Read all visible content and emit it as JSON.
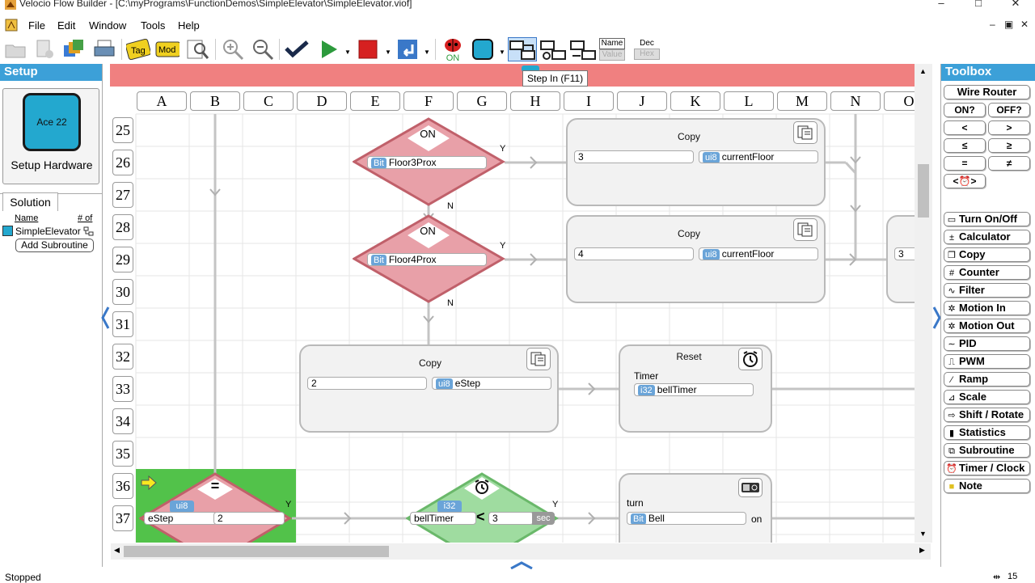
{
  "window": {
    "title": "Velocio Flow Builder - [C:\\myPrograms\\FunctionDemos\\SimpleElevator\\SimpleElevator.viof]",
    "controls": [
      "–",
      "□",
      "✕"
    ]
  },
  "menu": {
    "items": [
      "File",
      "Edit",
      "Window",
      "Tools",
      "Help"
    ],
    "mdi_controls": [
      "–",
      "▣",
      "✕"
    ]
  },
  "toolbar": {
    "tag_label": "Tag",
    "mod_label": "Mod",
    "on_label": "ON",
    "name_label": "Name",
    "value_label": "Value",
    "dec_label": "Dec",
    "hex_label": "Hex",
    "tooltip": "Step In (F11)"
  },
  "setup": {
    "header": "Setup",
    "device": "Ace 22",
    "button": "Setup Hardware"
  },
  "solution": {
    "tab": "Solution",
    "col_name": "Name",
    "col_count": "# of",
    "item": "SimpleElevator",
    "add_button": "Add Subroutine"
  },
  "grid": {
    "columns": [
      "A",
      "B",
      "C",
      "D",
      "E",
      "F",
      "G",
      "H",
      "I",
      "J",
      "K",
      "L",
      "M",
      "N",
      "O"
    ],
    "rows": [
      "25",
      "26",
      "27",
      "28",
      "29",
      "30",
      "31",
      "32",
      "33",
      "34",
      "35",
      "36",
      "37"
    ]
  },
  "flow": {
    "dec1": {
      "op": "ON",
      "tag": "Bit",
      "var": "Floor3Prox",
      "yes": "Y",
      "no": "N"
    },
    "dec2": {
      "op": "ON",
      "tag": "Bit",
      "var": "Floor4Prox",
      "yes": "Y",
      "no": "N"
    },
    "copy1": {
      "title": "Copy",
      "value": "3",
      "tag": "ui8",
      "var": "currentFloor"
    },
    "copy2": {
      "title": "Copy",
      "value": "4",
      "tag": "ui8",
      "var": "currentFloor"
    },
    "copy3": {
      "title": "Copy",
      "value": "2",
      "tag": "ui8",
      "var": "eStep"
    },
    "copy4_value": "3",
    "reset": {
      "title": "Reset",
      "label": "Timer",
      "tag": "i32",
      "var": "bellTimer"
    },
    "dec3": {
      "op": "=",
      "tag": "ui8",
      "var": "eStep",
      "value": "2",
      "yes": "Y"
    },
    "dec4": {
      "tag": "i32",
      "var": "bellTimer",
      "op": "<",
      "value": "3",
      "unit": "sec",
      "yes": "Y"
    },
    "turn": {
      "label": "turn",
      "tag": "Bit",
      "var": "Bell",
      "state": "on"
    }
  },
  "toolbox": {
    "header": "Toolbox",
    "wire_router": "Wire Router",
    "compare": [
      "ON?",
      "OFF?",
      "<",
      ">",
      "≤",
      "≥",
      "=",
      "≠",
      "<⏰>"
    ],
    "items": [
      {
        "icon": "turn-on-off-icon",
        "label": "Turn On/Off"
      },
      {
        "icon": "calculator-icon",
        "label": "Calculator"
      },
      {
        "icon": "copy-icon",
        "label": "Copy"
      },
      {
        "icon": "counter-icon",
        "label": "Counter"
      },
      {
        "icon": "filter-icon",
        "label": "Filter"
      },
      {
        "icon": "motion-in-icon",
        "label": "Motion In"
      },
      {
        "icon": "motion-out-icon",
        "label": "Motion Out"
      },
      {
        "icon": "pid-icon",
        "label": "PID"
      },
      {
        "icon": "pwm-icon",
        "label": "PWM"
      },
      {
        "icon": "ramp-icon",
        "label": "Ramp"
      },
      {
        "icon": "scale-icon",
        "label": "Scale"
      },
      {
        "icon": "shift-rotate-icon",
        "label": "Shift / Rotate"
      },
      {
        "icon": "statistics-icon",
        "label": "Statistics"
      },
      {
        "icon": "subroutine-icon",
        "label": "Subroutine"
      },
      {
        "icon": "timer-clock-icon",
        "label": "Timer / Clock"
      },
      {
        "icon": "note-icon",
        "label": "Note"
      }
    ]
  },
  "status": {
    "text": "Stopped",
    "right": "15"
  },
  "colors": {
    "accent": "#3ca0d8",
    "pink_bar": "#f08080",
    "decision_red": "#e8a0a8",
    "decision_green": "#9fdca0",
    "active_cell": "#52c24a"
  }
}
